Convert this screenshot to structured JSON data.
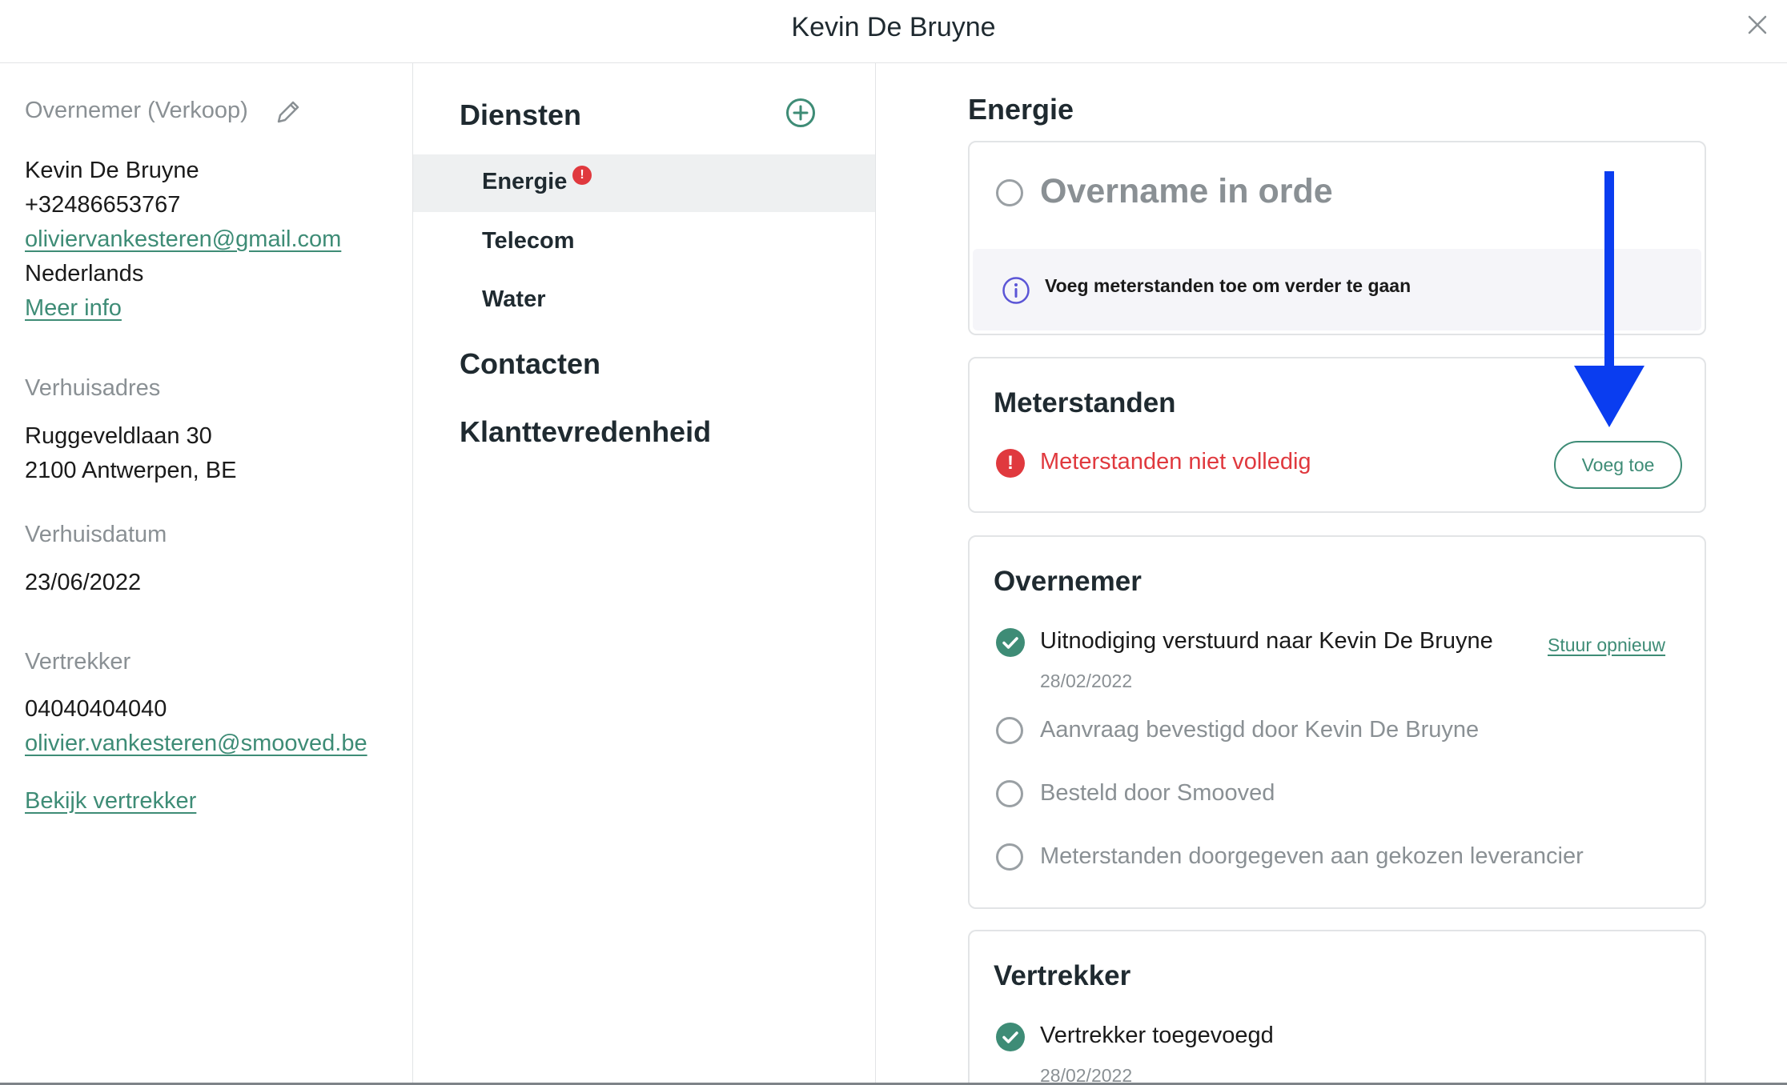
{
  "header": {
    "title": "Kevin De Bruyne"
  },
  "left": {
    "overnemer_label": "Overnemer (Verkoop)",
    "name": "Kevin De Bruyne",
    "phone": "+32486653767",
    "email": "oliviervankesteren@gmail.com",
    "language": "Nederlands",
    "more_info": "Meer info",
    "address_label": "Verhuisadres",
    "address_line1": "Ruggeveldlaan 30",
    "address_line2": "2100 Antwerpen, BE",
    "date_label": "Verhuisdatum",
    "date": "23/06/2022",
    "vertrekker_label": "Vertrekker",
    "vertrekker_phone": "04040404040",
    "vertrekker_email": "olivier.vankesteren@smooved.be",
    "view_vertrekker": "Bekijk vertrekker"
  },
  "middle": {
    "diensten": "Diensten",
    "services": [
      {
        "label": "Energie",
        "alert": "!"
      },
      {
        "label": "Telecom"
      },
      {
        "label": "Water"
      }
    ],
    "contacten": "Contacten",
    "klanttevredenheid": "Klanttevredenheid"
  },
  "right": {
    "title": "Energie",
    "status_card": {
      "title": "Overname in orde",
      "info": "Voeg meterstanden toe om verder te gaan"
    },
    "meters_card": {
      "title": "Meterstanden",
      "warning_icon": "!",
      "warning": "Meterstanden niet volledig",
      "button": "Voeg toe"
    },
    "overnemer_card": {
      "title": "Overnemer",
      "steps": [
        {
          "text": "Uitnodiging verstuurd naar Kevin De Bruyne",
          "date": "28/02/2022",
          "done": true
        },
        {
          "text": "Aanvraag bevestigd door Kevin De Bruyne",
          "done": false
        },
        {
          "text": "Besteld door Smooved",
          "done": false
        },
        {
          "text": "Meterstanden doorgegeven aan gekozen leverancier",
          "done": false
        }
      ],
      "resend": "Stuur opnieuw"
    },
    "vertrekker_card": {
      "title": "Vertrekker",
      "step": {
        "text": "Vertrekker toegevoegd",
        "date": "28/02/2022",
        "done": true
      }
    }
  },
  "colors": {
    "accent": "#3e8c76",
    "alert": "#e0393e",
    "info": "#5b55d6",
    "arrow": "#0a3df0"
  }
}
